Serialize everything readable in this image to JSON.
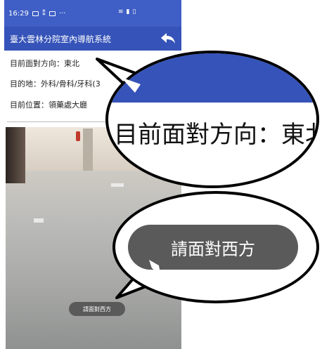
{
  "status_bar": {
    "time": "16:29",
    "icons": [
      "image-icon",
      "wifi-icon",
      "signal-icon",
      "battery-icon"
    ],
    "dots": "···"
  },
  "app_bar": {
    "title": "臺大雲林分院室內導航系統",
    "back_icon": "back-arrow-icon"
  },
  "info": {
    "facing": "目前面對方向：東北",
    "destination": "目的地：外科/骨科/牙科(3",
    "current_location": "目前位置：領藥處大廳"
  },
  "toast": {
    "message": "請面對西方"
  },
  "zoom_callouts": {
    "facing_zoom": "目前面對方向：東北",
    "toast_zoom": "請面對西方"
  },
  "colors": {
    "status_bar": "#3f5fc6",
    "app_bar": "#3553b8",
    "toast": "#5a5a5a"
  }
}
